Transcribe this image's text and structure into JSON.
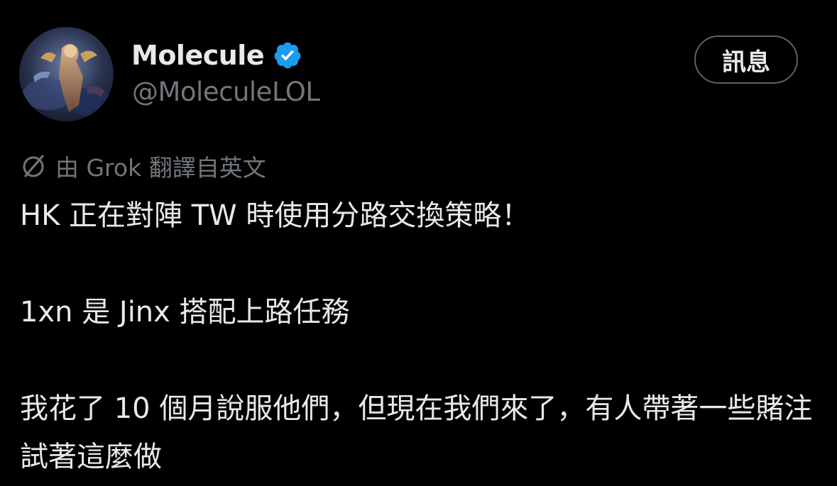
{
  "author": {
    "display_name": "Molecule",
    "handle": "@MoleculeLOL",
    "verified": true,
    "avatar_icon": "avatar-portrait-icon",
    "verified_color": "#1d9bf0"
  },
  "actions": {
    "message_label": "訊息"
  },
  "translation": {
    "icon": "grok-icon",
    "note": "由 Grok 翻譯自英文"
  },
  "tweet": {
    "paragraphs": [
      "HK 正在對陣 TW 時使用分路交換策略！",
      "1xn 是 Jinx 搭配上路任務",
      "我花了 10 個月說服他們，但現在我們來了，有人帶著一些賭注試著這麼做"
    ]
  },
  "colors": {
    "background": "#000000",
    "primary_text": "#e7e9ea",
    "secondary_text": "#71767b",
    "button_border": "#536471"
  }
}
